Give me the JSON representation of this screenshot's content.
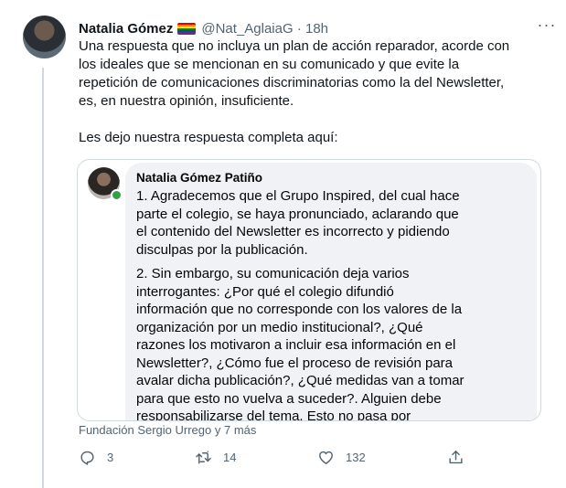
{
  "author": {
    "name": "Natalia Gómez",
    "handle": "@Nat_AglaiaG",
    "time": "18h",
    "flag_colors": [
      "#e40303",
      "#ff8c00",
      "#ffed00",
      "#008026",
      "#24408e",
      "#732982"
    ]
  },
  "more_label": "···",
  "tweet": {
    "text": "Una respuesta que no incluya un plan de acción reparador, acorde con\nlos ideales que se mencionan en su comunicado y que evite la\nrepetición de comunicaciones discriminatorias como la del Newsletter,\nes, en nuestra opinión, insuficiente.\n\nLes dejo nuestra respuesta completa aquí:"
  },
  "quote": {
    "name": "Natalia Gómez Patiño",
    "paragraph1": "1. Agradecemos que el Grupo Inspired, del cual hace\nparte el colegio, se haya pronunciado, aclarando que\nel contenido del Newsletter es incorrecto y pidiendo\ndisculpas por la publicación.",
    "paragraph2": "2. Sin embargo, su comunicación deja varios\ninterrogantes: ¿Por qué el colegio difundió\ninformación que no corresponde con los valores de la\norganización por un medio institucional?, ¿Qué\nrazones los motivaron a incluir esa información en el\nNewsletter?, ¿Cómo fue el proceso de revisión para\navalar dicha publicación?, ¿Qué medidas van a tomar\npara que esto no vuelva a suceder?. Alguien debe\nresponsabilizarse del tema. Esto no pasa por"
  },
  "attribution": "Fundación Sergio Urrego y 7 más",
  "actions": {
    "reply_count": "3",
    "retweet_count": "14",
    "like_count": "132",
    "icons": [
      "reply-icon",
      "retweet-icon",
      "like-icon",
      "share-icon"
    ]
  }
}
